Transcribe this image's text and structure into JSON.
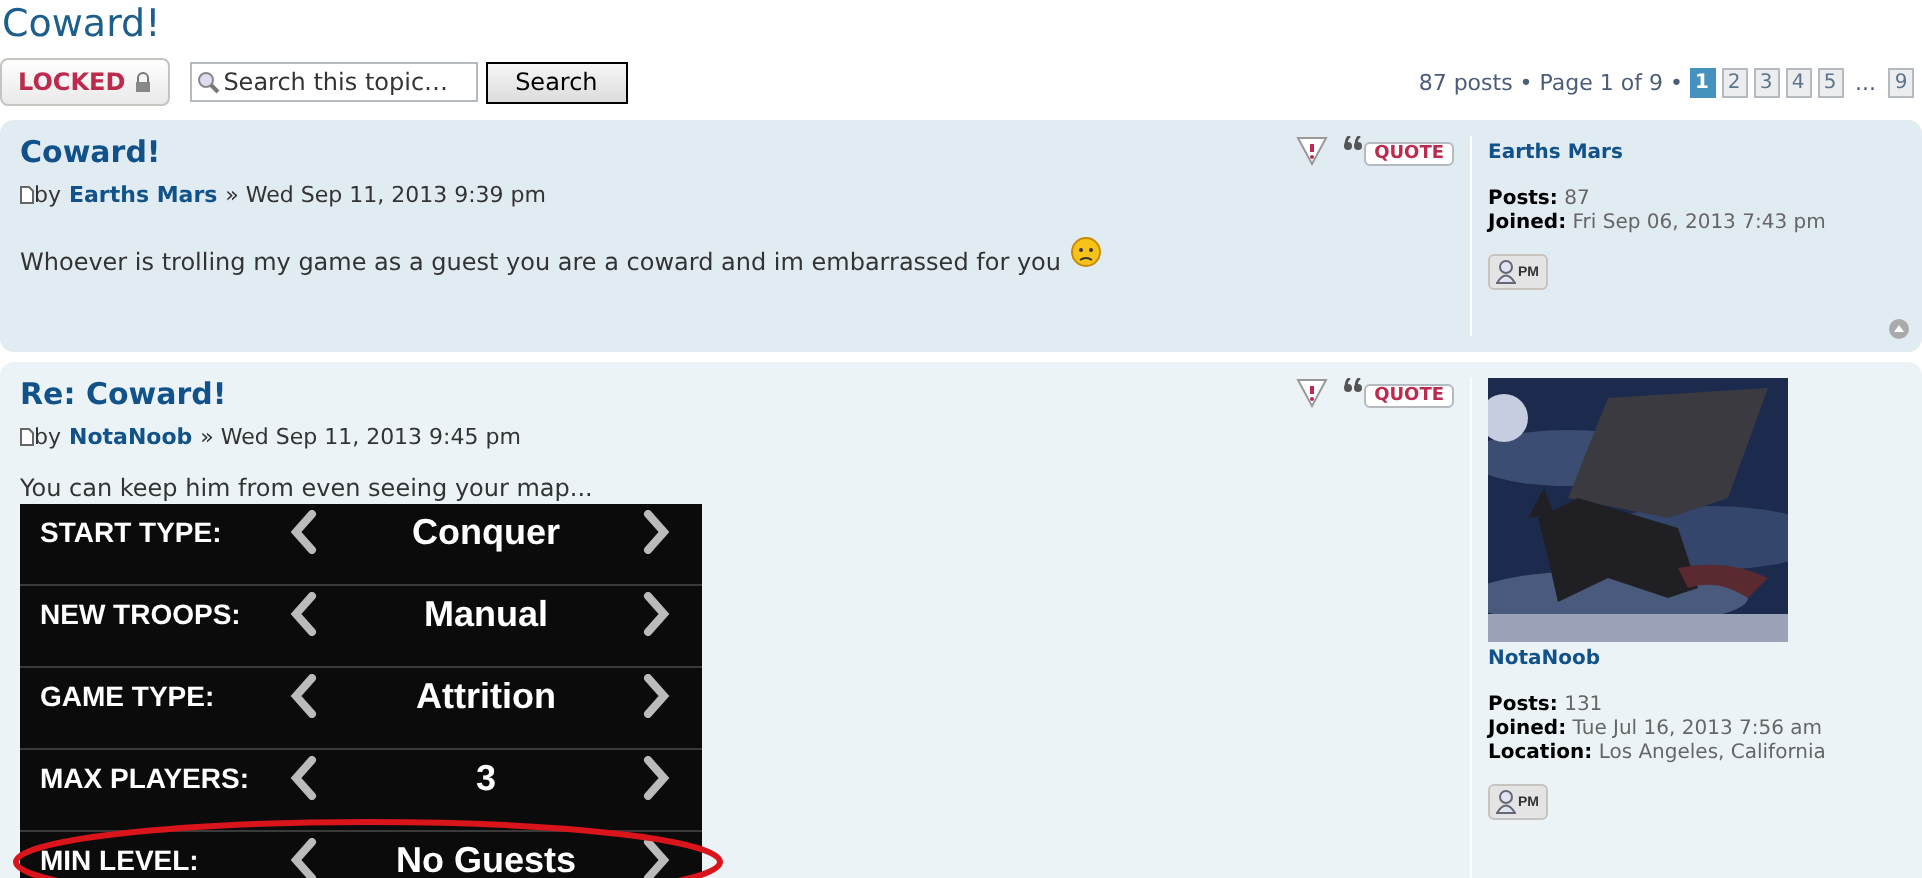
{
  "topic_title": "Coward!",
  "toolbar": {
    "locked_button": "LOCKED",
    "search": {
      "placeholder": "Search this topic…",
      "button": "Search"
    },
    "pagination": {
      "summary": "87 posts • Page 1 of 9 •",
      "pages": [
        {
          "kind": "page",
          "label": "1",
          "selected": true
        },
        {
          "kind": "page",
          "label": "2",
          "selected": false
        },
        {
          "kind": "page",
          "label": "3",
          "selected": false
        },
        {
          "kind": "page",
          "label": "4",
          "selected": false
        },
        {
          "kind": "page",
          "label": "5",
          "selected": false
        },
        {
          "kind": "ellipsis",
          "label": "..."
        },
        {
          "kind": "page",
          "label": "9",
          "selected": false
        }
      ]
    }
  },
  "posts": [
    {
      "title": "Coward!",
      "byline_prefix": "by",
      "author": "Earths Mars",
      "date": "» Wed Sep 11, 2013 9:39 pm",
      "quote_button": "QUOTE",
      "body": "Whoever is trolling my game as a guest you are a coward and im embarrassed for you",
      "smiley": true,
      "back_to_top": true,
      "profile": {
        "name": "Earths Mars",
        "fields": [
          {
            "label": "Posts:",
            "value": "87"
          },
          {
            "label": "Joined:",
            "value": "Fri Sep 06, 2013 7:43 pm"
          }
        ],
        "pm_button": "PM"
      }
    },
    {
      "title": "Re: Coward!",
      "byline_prefix": "by",
      "author": "NotaNoob",
      "date": "» Wed Sep 11, 2013 9:45 pm",
      "quote_button": "QUOTE",
      "body": "You can keep him from even seeing your map...",
      "smiley": false,
      "back_to_top": false,
      "settings": [
        {
          "label": "START TYPE:",
          "value": "Conquer",
          "circled": false
        },
        {
          "label": "NEW TROOPS:",
          "value": "Manual",
          "circled": false
        },
        {
          "label": "GAME TYPE:",
          "value": "Attrition",
          "circled": false
        },
        {
          "label": "MAX PLAYERS:",
          "value": "3",
          "circled": false
        },
        {
          "label": "MIN LEVEL:",
          "value": "No Guests",
          "circled": true
        }
      ],
      "profile": {
        "name": "NotaNoob",
        "fields": [
          {
            "label": "Posts:",
            "value": "131"
          },
          {
            "label": "Joined:",
            "value": "Tue Jul 16, 2013 7:56 am"
          },
          {
            "label": "Location:",
            "value": "Los Angeles, California"
          }
        ],
        "pm_button": "PM"
      }
    }
  ]
}
